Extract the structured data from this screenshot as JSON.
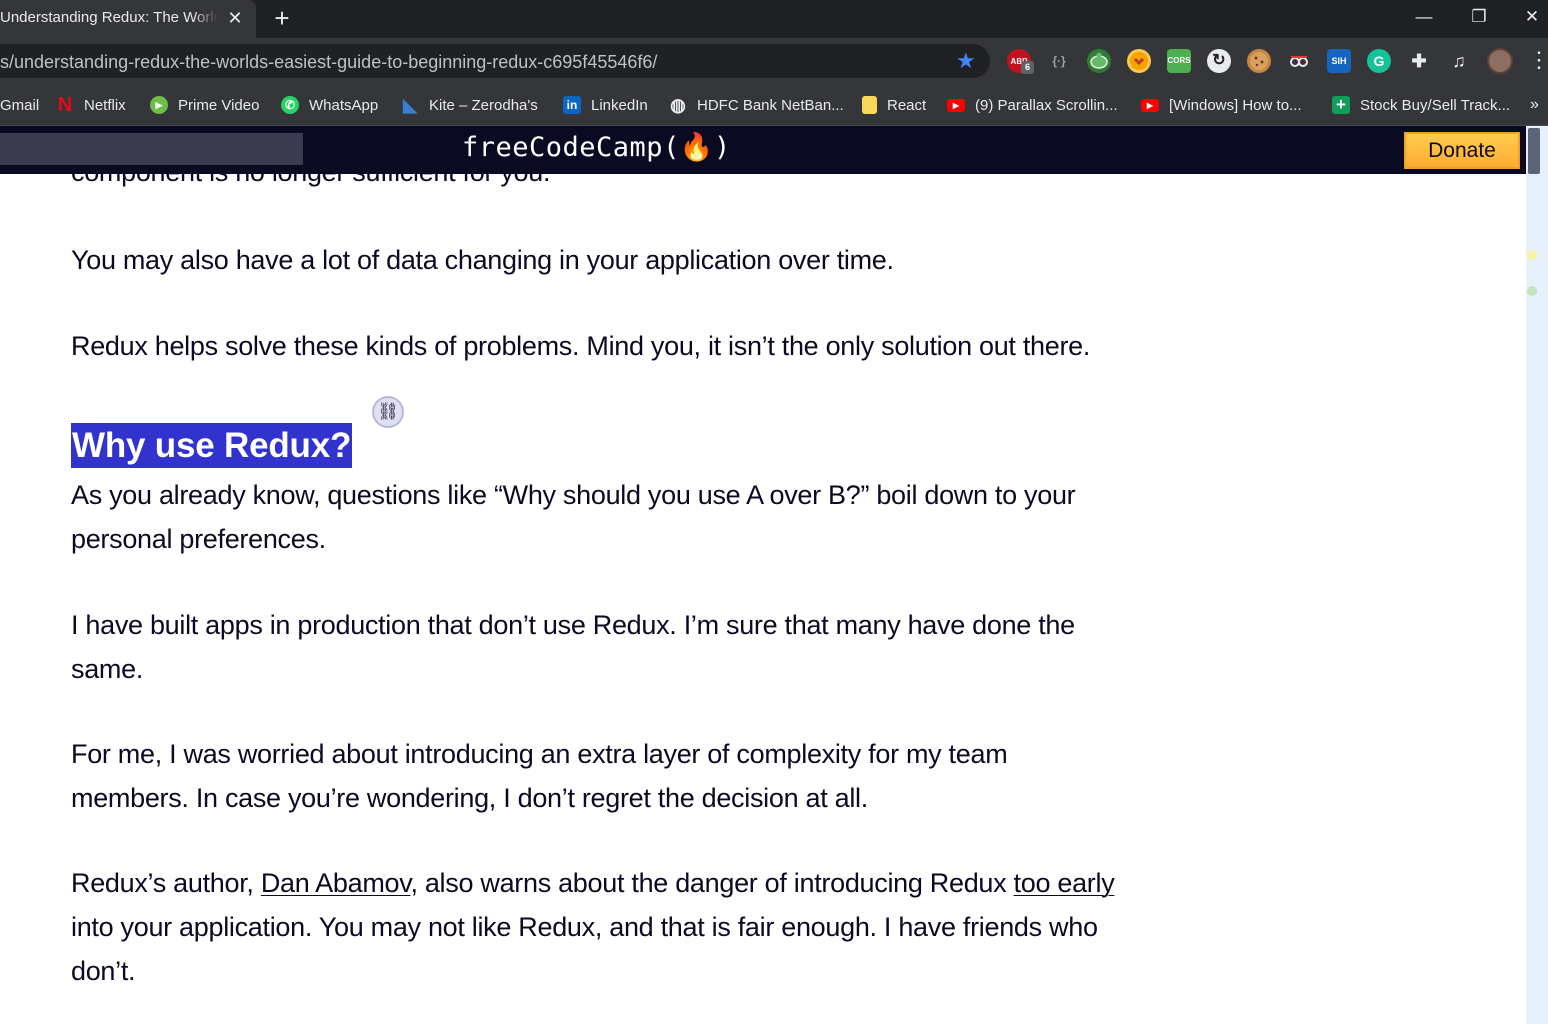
{
  "browser": {
    "tab": {
      "title": "Understanding Redux: The World's Easiest Guide to Beginning Redux",
      "close_glyph": "✕"
    },
    "new_tab_glyph": "+",
    "window_controls": {
      "minimize": "—",
      "restore": "❐",
      "close": "✕"
    },
    "url": "s/understanding-redux-the-worlds-easiest-guide-to-beginning-redux-c695f45546f6/",
    "extensions": {
      "abp_label": "ABP",
      "abp_badge": "6",
      "cors_label": "CORS",
      "sih_label": "SIH",
      "grammarly_label": "G"
    },
    "bookmarks": [
      {
        "label": "Gmail",
        "icon": "gmail-icon"
      },
      {
        "label": "Netflix",
        "icon": "netflix-icon",
        "glyph": "N",
        "color": "#e50914"
      },
      {
        "label": "Prime Video",
        "icon": "prime-video-icon",
        "glyph": "▶",
        "color": "#6cbf46"
      },
      {
        "label": "WhatsApp",
        "icon": "whatsapp-icon",
        "glyph": "✆",
        "color": "#25d366"
      },
      {
        "label": "Kite – Zerodha's",
        "icon": "kite-icon",
        "glyph": "◣",
        "color": "#387ed1"
      },
      {
        "label": "LinkedIn",
        "icon": "linkedin-icon",
        "glyph": "in",
        "color": "#0a66c2"
      },
      {
        "label": "HDFC Bank NetBan...",
        "icon": "globe-icon",
        "glyph": "◍",
        "color": "#9aa0a6"
      },
      {
        "label": "React",
        "icon": "folder-note-icon",
        "glyph": "",
        "color": "#f9d85a"
      },
      {
        "label": "(9) Parallax Scrollin...",
        "icon": "youtube-icon",
        "glyph": "▶",
        "color": "#ff0000"
      },
      {
        "label": "[Windows] How to...",
        "icon": "youtube-icon",
        "glyph": "▶",
        "color": "#ff0000"
      },
      {
        "label": "Stock Buy/Sell Track...",
        "icon": "sheets-plus-icon",
        "glyph": "+",
        "color": "#0f9d58"
      }
    ],
    "bookmarks_overflow": "»",
    "menu_glyph": "⋮"
  },
  "site": {
    "logo": "freeCodeCamp(🔥)",
    "donate_label": "Donate",
    "colors": {
      "nav_bg": "#0a0a23",
      "donate": "#ffbf00",
      "heading_highlight": "#3232cd"
    }
  },
  "article": {
    "cutoff_line": "component is no longer sufficient for you.",
    "p1": "You may also have a lot of data changing in your application over time.",
    "p2": "Redux helps solve these kinds of problems. Mind you, it isn’t the only solution out there.",
    "heading": "Why use Redux?",
    "anchor_glyph": "⛓",
    "p3": "As you already know, questions like “Why should you use A over B?” boil down to your personal preferences.",
    "p4": "I have built apps in production that don’t use Redux. I’m sure that many have done the same.",
    "p5": "For me, I was worried about introducing an extra layer of complexity for my team members. In case you’re wondering, I don’t regret the decision at all.",
    "p6_before": "Redux’s author, ",
    "p6_link1": "Dan Abamov",
    "p6_middle": ", also warns about the danger of introducing Redux ",
    "p6_link2": "too early",
    "p6_after": " into your application. You may not like Redux, and that is fair enough. I have friends who don’t."
  }
}
